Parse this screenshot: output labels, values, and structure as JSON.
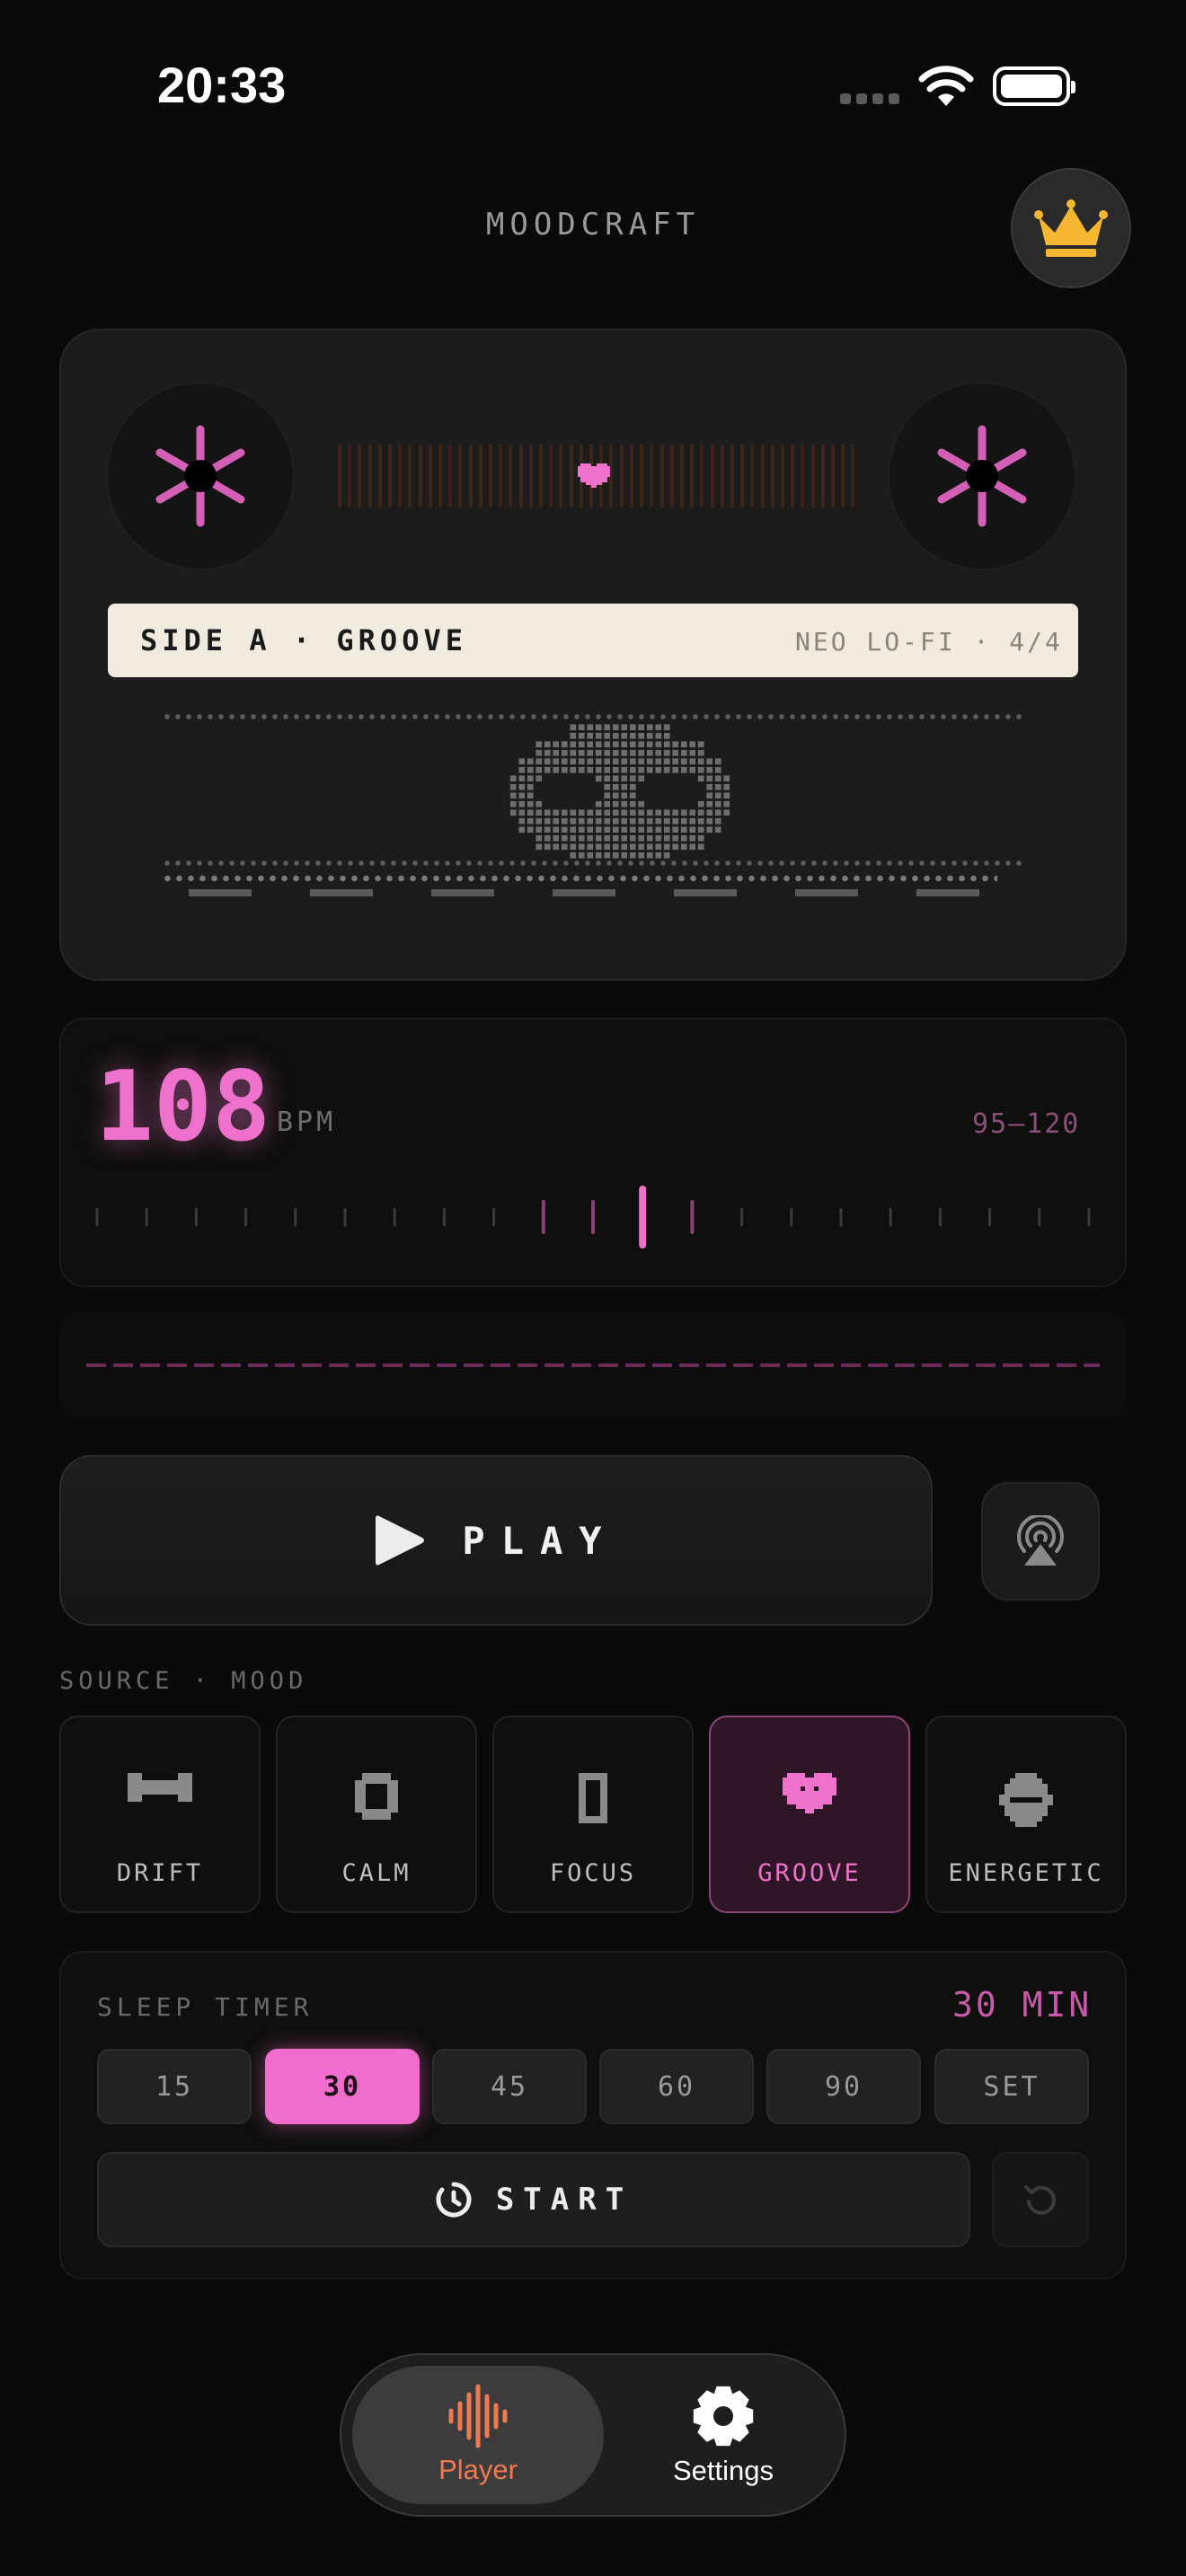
{
  "status_bar": {
    "time": "20:33"
  },
  "app": {
    "title": "MOODCRAFT"
  },
  "cassette": {
    "side_label": "SIDE A · GROOVE",
    "genre_label": "NEO LO-FI · 4/4"
  },
  "bpm": {
    "value": "108",
    "unit": "BPM",
    "range": "95–120"
  },
  "play": {
    "label": "PLAY"
  },
  "mood": {
    "section_label": "SOURCE · MOOD",
    "items": [
      {
        "label": "DRIFT",
        "icon": "drift-icon"
      },
      {
        "label": "CALM",
        "icon": "calm-icon"
      },
      {
        "label": "FOCUS",
        "icon": "focus-icon"
      },
      {
        "label": "GROOVE",
        "icon": "heart-icon"
      },
      {
        "label": "ENERGETIC",
        "icon": "energetic-icon"
      }
    ],
    "selected": "GROOVE"
  },
  "sleep_timer": {
    "label": "SLEEP TIMER",
    "value": "30 MIN",
    "options": [
      "15",
      "30",
      "45",
      "60",
      "90",
      "SET"
    ],
    "selected": "30",
    "start_label": "START"
  },
  "tabs": [
    {
      "label": "Player",
      "icon": "waveform-icon",
      "active": true
    },
    {
      "label": "Settings",
      "icon": "gear-icon",
      "active": false
    }
  ],
  "colors": {
    "accent": "#ee72cc",
    "background": "#0a0a0a",
    "crown": "#f5b731",
    "tab_active": "#f07a4f"
  }
}
